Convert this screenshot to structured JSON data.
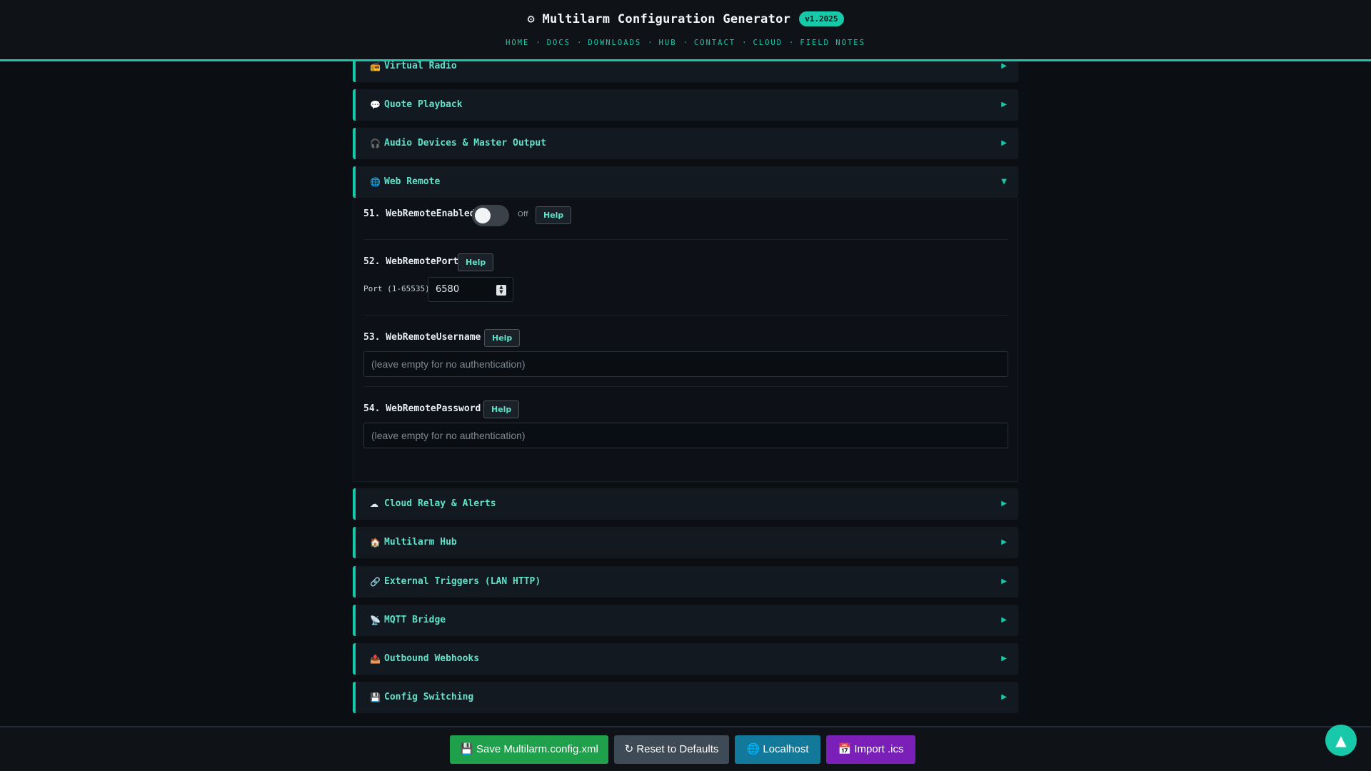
{
  "header": {
    "title": "⚙ Multilarm Configuration Generator",
    "version": "v1.2025",
    "nav": [
      "HOME",
      "DOCS",
      "DOWNLOADS",
      "HUB",
      "CONTACT",
      "CLOUD",
      "FIELD NOTES"
    ],
    "nav_separator": "·"
  },
  "sections_top": [
    {
      "icon": "📻",
      "label": "Virtual Radio",
      "chevron": "▶"
    },
    {
      "icon": "💬",
      "label": "Quote Playback",
      "chevron": "▶"
    },
    {
      "icon": "🎧",
      "label": "Audio Devices & Master Output",
      "chevron": "▶"
    }
  ],
  "web_remote": {
    "icon": "🌐",
    "label": "Web Remote",
    "chevron": "▼",
    "fields": {
      "enabled": {
        "name": "51. WebRemoteEnabled",
        "state": "Off",
        "help": "Help"
      },
      "port": {
        "name": "52. WebRemotePort",
        "help": "Help",
        "port_label": "Port (1-65535):",
        "value": "6580"
      },
      "username": {
        "name": "53. WebRemoteUsername",
        "help": "Help",
        "placeholder": "(leave empty for no authentication)"
      },
      "password": {
        "name": "54. WebRemotePassword",
        "help": "Help",
        "placeholder": "(leave empty for no authentication)"
      }
    }
  },
  "sections_bottom": [
    {
      "icon": "☁",
      "label": "Cloud Relay & Alerts",
      "chevron": "▶"
    },
    {
      "icon": "🏠",
      "label": "Multilarm Hub",
      "chevron": "▶"
    },
    {
      "icon": "🔗",
      "label": "External Triggers (LAN HTTP)",
      "chevron": "▶"
    },
    {
      "icon": "📡",
      "label": "MQTT Bridge",
      "chevron": "▶"
    },
    {
      "icon": "📤",
      "label": "Outbound Webhooks",
      "chevron": "▶"
    },
    {
      "icon": "💾",
      "label": "Config Switching",
      "chevron": "▶"
    }
  ],
  "footer": {
    "save": "💾 Save Multilarm.config.xml",
    "reset": "↻ Reset to Defaults",
    "localhost": "🌐 Localhost",
    "import": "📅 Import .ics"
  },
  "scroll_top": "▲",
  "colors": {
    "accent": "#17c9a8",
    "save": "#1fa04a",
    "reset": "#3e4a55",
    "localhost": "#13799b",
    "import": "#7a20b8"
  }
}
